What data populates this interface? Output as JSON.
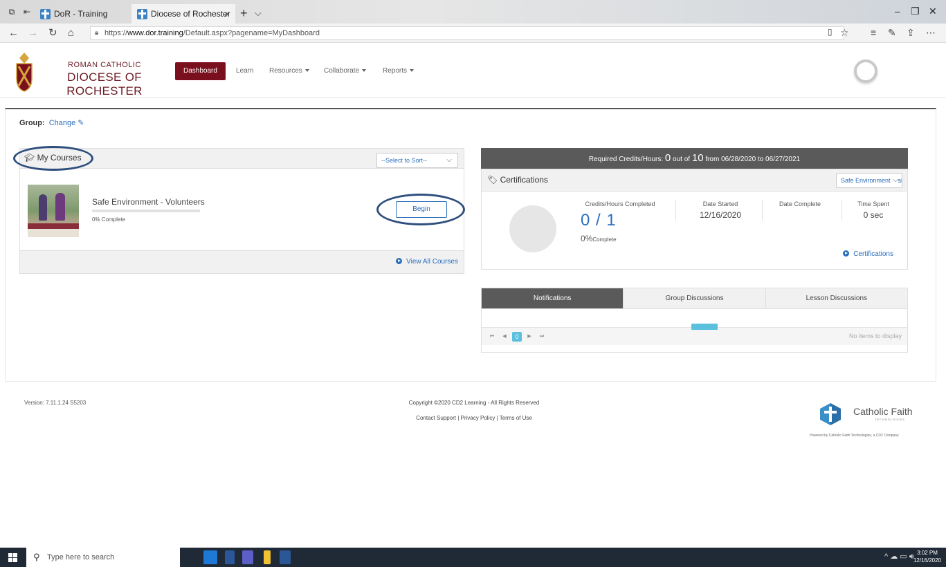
{
  "browser": {
    "tabs": [
      {
        "label": "DoR - Training"
      },
      {
        "label": "Diocese of Rochester"
      }
    ],
    "url_prefix": "https://",
    "url_domain": "www.dor.training",
    "url_path": "/Default.aspx?pagename=MyDashboard",
    "new_tab": "+",
    "tab_menu": "⌵"
  },
  "header": {
    "logo_line1": "ROMAN CATHOLIC",
    "logo_line2": "DIOCESE OF ROCHESTER",
    "nav": [
      {
        "label": "Dashboard",
        "active": true
      },
      {
        "label": "Learn"
      },
      {
        "label": "Resources"
      },
      {
        "label": "Collaborate"
      },
      {
        "label": "Reports"
      }
    ]
  },
  "group": {
    "label": "Group:",
    "change": "Change"
  },
  "my_courses": {
    "title": "My Courses",
    "sort_placeholder": "--Select to Sort--",
    "course": {
      "name": "Safe Environment - Volunteers",
      "progress_percent": 0,
      "progress_label": "0% Complete",
      "begin": "Begin"
    },
    "view_all": "View All Courses"
  },
  "required": {
    "prefix": "Required Credits/Hours:",
    "earned": "0",
    "out_of": "out of",
    "total": "10",
    "range": "from 06/28/2020 to 06/27/2021"
  },
  "certifications": {
    "title": "Certifications",
    "selected": "Safe Environment Trai",
    "credits_label": "Credits/Hours Completed",
    "credits_value": "0 / 1",
    "pct": "0%",
    "pct_word": "Complete",
    "date_started_label": "Date Started",
    "date_started": "12/16/2020",
    "date_complete_label": "Date Complete",
    "time_spent_label": "Time Spent",
    "time_spent": "0 sec",
    "link": "Certifications"
  },
  "discussions": {
    "tabs": [
      "Notifications",
      "Group Discussions",
      "Lesson Discussions"
    ],
    "active_tab": 0,
    "page": "0",
    "empty": "No items to display"
  },
  "footer": {
    "version": "Version: 7.11.1.24 S5203",
    "copyright": "Copyright ©2020 CD2 Learning - All Rights Reserved",
    "links": "Contact Support | Privacy Policy | Terms of Use",
    "brand": "Catholic Faith",
    "brand_sub": "TECHNOLOGIES",
    "powered": "Powered by Catholic Faith Technologies, a CD2 Company"
  },
  "taskbar": {
    "search_placeholder": "Type here to search",
    "time": "3:02 PM",
    "date": "12/16/2020"
  },
  "colors": {
    "brand_maroon": "#7a0f1d",
    "link_blue": "#2a6ebb",
    "annotation_oval": "#2e4e7e"
  }
}
